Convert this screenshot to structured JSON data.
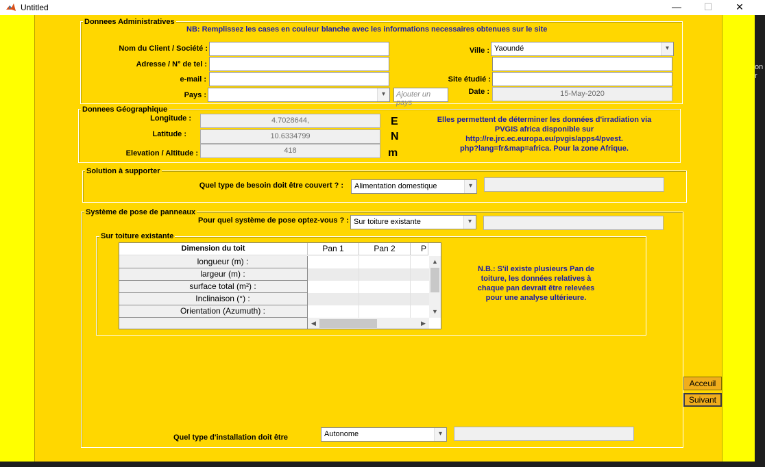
{
  "window": {
    "title": "Untitled",
    "minimize": "—",
    "maximize": "☐",
    "close": "✕"
  },
  "background_text": "on\nr",
  "admin": {
    "title": "Donnees Administratives",
    "note": "NB: Remplissez les cases en couleur blanche avec les informations necessaires obtenues sur le site",
    "client_label": "Nom du Client / Société :",
    "client_value": "",
    "address_label": "Adresse / N° de tel :",
    "address_value": "",
    "email_label": "e-mail :",
    "email_value": "",
    "country_label": "Pays :",
    "country_value": "",
    "add_country_placeholder": "Ajouter un pays",
    "city_label": "Ville :",
    "city_value": "Yaoundé",
    "city_extra_value": "",
    "site_label": "Site étudié :",
    "site_value": "",
    "date_label": "Date :",
    "date_value": "15-May-2020"
  },
  "geo": {
    "title": "Donnees Géographique",
    "longitude_label": "Longitude :",
    "longitude_value": "4.7028644,",
    "longitude_unit": "E",
    "latitude_label": "Latitude :",
    "latitude_value": "10.6334799",
    "latitude_unit": "N",
    "elevation_label": "Elevation / Altitude :",
    "elevation_value": "418",
    "elevation_unit": "m",
    "info_line1": "Elles permettent de déterminer les données d'irradiation via",
    "info_line2": "PVGIS africa disponible sur",
    "info_line3": "http://re.jrc.ec.europa.eu/pvgis/apps4/pvest.",
    "info_line4": "php?lang=fr&map=africa. Pour la zone Afrique."
  },
  "solution": {
    "title": "Solution à supporter",
    "need_label": "Quel type de besoin doit être couvert ? :",
    "need_value": "Alimentation domestique",
    "need_extra": ""
  },
  "mounting": {
    "title": "Système de pose de panneaux",
    "system_label": "Pour quel système de pose optez-vous ? :",
    "system_value": "Sur toiture existante",
    "system_extra": "",
    "roof_title": "Sur toiture existante",
    "table": {
      "corner": "Dimension du toit",
      "columns": [
        "Pan 1",
        "Pan 2",
        "P"
      ],
      "rows": [
        "longueur (m) :",
        "largeur (m) :",
        "surface total (m²) :",
        "Inclinaison (°) :",
        "Orientation (Azumuth) :"
      ]
    },
    "note_line1": "N.B.: S'il existe plusieurs Pan de",
    "note_line2": "toiture, les données relatives à",
    "note_line3": "chaque pan devrait être relevées",
    "note_line4": "pour une analyse ultérieure.",
    "install_label": "Quel type d'installation doit être",
    "install_value": "Autonome",
    "install_extra": ""
  },
  "buttons": {
    "home": "Acceuil",
    "next": "Suivant"
  },
  "icons": {
    "dropdown": "chevron-down-icon",
    "app": "matlab-icon"
  }
}
